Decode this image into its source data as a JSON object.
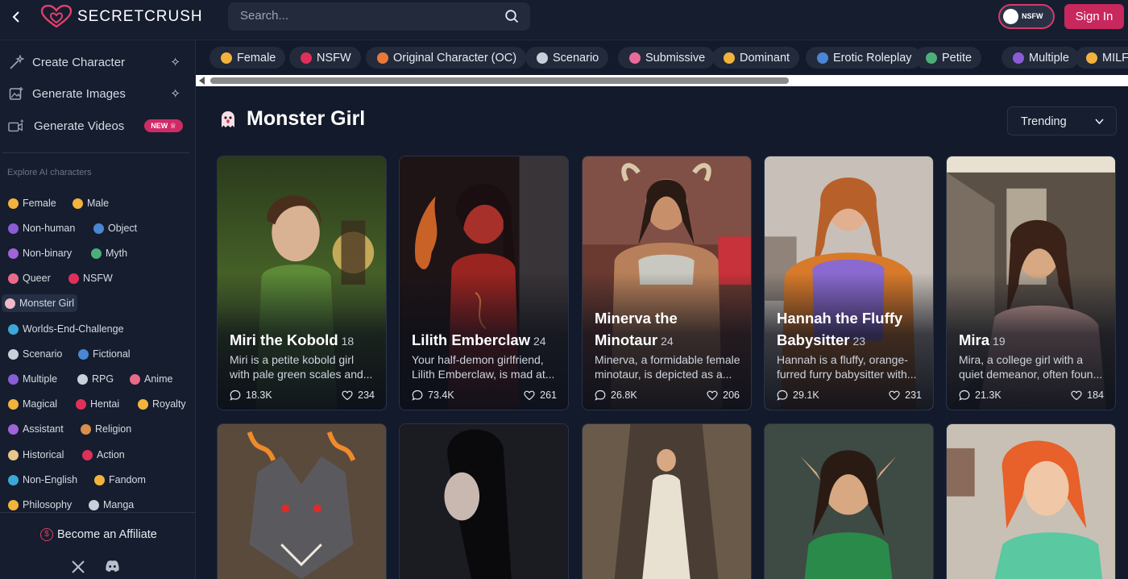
{
  "header": {
    "logo_text": "SECRETCRUSH",
    "search_placeholder": "Search...",
    "nsfw_label": "NSFW",
    "signin_label": "Sign In"
  },
  "sidebar": {
    "actions": [
      {
        "label": "Create Character"
      },
      {
        "label": "Generate Images"
      },
      {
        "label": "Generate Videos",
        "badge": "NEW"
      }
    ],
    "explore_title": "Explore AI characters",
    "categories": [
      {
        "label": "Female",
        "color": "#f2b33d"
      },
      {
        "label": "Male",
        "color": "#f2b33d"
      },
      {
        "label": "Non-human",
        "color": "#8a5cd6"
      },
      {
        "label": "Object",
        "color": "#4a86d4"
      },
      {
        "label": "Non-binary",
        "color": "#a063d8"
      },
      {
        "label": "Myth",
        "color": "#4caf7a"
      },
      {
        "label": "Queer",
        "color": "#e86b8a"
      },
      {
        "label": "NSFW",
        "color": "#e0305a"
      },
      {
        "label": "Monster Girl",
        "color": "#f0b8c8"
      },
      {
        "label": "Worlds-End-Challenge",
        "color": "#3ca8d8"
      },
      {
        "label": "Scenario",
        "color": "#c9d0dc"
      },
      {
        "label": "Fictional",
        "color": "#4a86d4"
      },
      {
        "label": "Multiple",
        "color": "#8a5cd6"
      },
      {
        "label": "RPG",
        "color": "#c9d0dc"
      },
      {
        "label": "Anime",
        "color": "#e86b8a"
      },
      {
        "label": "Magical",
        "color": "#f2b33d"
      },
      {
        "label": "Hentai",
        "color": "#e0305a"
      },
      {
        "label": "Royalty",
        "color": "#f2b33d"
      },
      {
        "label": "Assistant",
        "color": "#a063d8"
      },
      {
        "label": "Religion",
        "color": "#d8904a"
      },
      {
        "label": "Historical",
        "color": "#e8c88a"
      },
      {
        "label": "Action",
        "color": "#e0305a"
      },
      {
        "label": "Non-English",
        "color": "#3ca8d8"
      },
      {
        "label": "Fandom",
        "color": "#f2b33d"
      },
      {
        "label": "Philosophy",
        "color": "#f2b33d"
      },
      {
        "label": "Manga",
        "color": "#c9d0dc"
      }
    ],
    "affiliate_label": "Become an Affiliate"
  },
  "tags": [
    {
      "label": "Female",
      "color": "#f2b33d"
    },
    {
      "label": "NSFW",
      "color": "#e0305a"
    },
    {
      "label": "Original Character (OC)",
      "color": "#e8793a"
    },
    {
      "label": "Scenario",
      "color": "#c9d0dc"
    },
    {
      "label": "Submissive",
      "color": "#e86b9a"
    },
    {
      "label": "Dominant",
      "color": "#f2b33d"
    },
    {
      "label": "Erotic Roleplay",
      "color": "#4a86d4"
    },
    {
      "label": "Petite",
      "color": "#4caf7a"
    },
    {
      "label": "Multiple",
      "color": "#8a5cd6"
    },
    {
      "label": "MILF",
      "color": "#f2b33d"
    }
  ],
  "page": {
    "title": "Monster Girl",
    "sort_value": "Trending"
  },
  "cards": [
    {
      "name": "Miri the Kobold",
      "age": "18",
      "desc1": "Miri is a petite kobold girl",
      "desc2": "with pale green scales and...",
      "chats": "18.3K",
      "likes": "234"
    },
    {
      "name": "Lilith Emberclaw",
      "age": "24",
      "desc1": "Your half-demon girlfriend,",
      "desc2": "Lilith Emberclaw, is mad at...",
      "chats": "73.4K",
      "likes": "261"
    },
    {
      "name": "Minerva the Minotaur",
      "age": "24",
      "desc1": "Minerva, a formidable female",
      "desc2": "minotaur, is depicted as a...",
      "chats": "26.8K",
      "likes": "206"
    },
    {
      "name": "Hannah the Fluffy Babysitter",
      "age": "23",
      "desc1": "Hannah is a fluffy, orange-",
      "desc2": "furred furry babysitter with...",
      "chats": "29.1K",
      "likes": "231"
    },
    {
      "name": "Mira",
      "age": "19",
      "desc1": "Mira, a college girl with a",
      "desc2": "quiet demeanor, often foun...",
      "chats": "21.3K",
      "likes": "184"
    }
  ],
  "colors": {
    "accent": "#c8285d",
    "background": "#121a2b",
    "panel": "#151d2e"
  }
}
